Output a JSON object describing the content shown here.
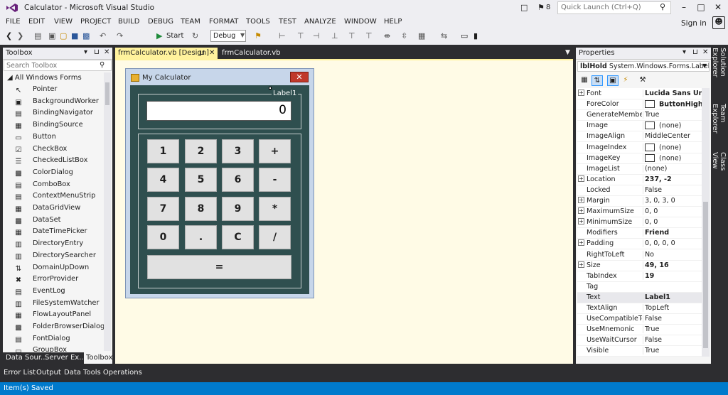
{
  "window": {
    "title": "Calculator - Microsoft Visual Studio",
    "notification_count": "8"
  },
  "quick_launch": {
    "placeholder": "Quick Launch (Ctrl+Q)"
  },
  "menu": [
    "FILE",
    "EDIT",
    "VIEW",
    "PROJECT",
    "BUILD",
    "DEBUG",
    "TEAM",
    "FORMAT",
    "TOOLS",
    "TEST",
    "ANALYZE",
    "WINDOW",
    "HELP"
  ],
  "account": {
    "sign_in": "Sign in"
  },
  "toolbar": {
    "start_label": "Start",
    "config": "Debug"
  },
  "toolbox": {
    "title": "Toolbox",
    "search_placeholder": "Search Toolbox",
    "group": "All Windows Forms",
    "items": [
      {
        "label": "Pointer",
        "icon": "pointer-icon"
      },
      {
        "label": "BackgroundWorker",
        "icon": "background-worker-icon"
      },
      {
        "label": "BindingNavigator",
        "icon": "binding-navigator-icon"
      },
      {
        "label": "BindingSource",
        "icon": "binding-source-icon"
      },
      {
        "label": "Button",
        "icon": "button-icon"
      },
      {
        "label": "CheckBox",
        "icon": "checkbox-icon"
      },
      {
        "label": "CheckedListBox",
        "icon": "checked-listbox-icon"
      },
      {
        "label": "ColorDialog",
        "icon": "color-dialog-icon"
      },
      {
        "label": "ComboBox",
        "icon": "combobox-icon"
      },
      {
        "label": "ContextMenuStrip",
        "icon": "context-menu-icon"
      },
      {
        "label": "DataGridView",
        "icon": "datagrid-icon"
      },
      {
        "label": "DataSet",
        "icon": "dataset-icon"
      },
      {
        "label": "DateTimePicker",
        "icon": "datetime-picker-icon"
      },
      {
        "label": "DirectoryEntry",
        "icon": "directory-entry-icon"
      },
      {
        "label": "DirectorySearcher",
        "icon": "directory-searcher-icon"
      },
      {
        "label": "DomainUpDown",
        "icon": "domain-updown-icon"
      },
      {
        "label": "ErrorProvider",
        "icon": "error-provider-icon"
      },
      {
        "label": "EventLog",
        "icon": "eventlog-icon"
      },
      {
        "label": "FileSystemWatcher",
        "icon": "filesystem-watcher-icon"
      },
      {
        "label": "FlowLayoutPanel",
        "icon": "flow-layout-icon"
      },
      {
        "label": "FolderBrowserDialog",
        "icon": "folder-browser-icon"
      },
      {
        "label": "FontDialog",
        "icon": "font-dialog-icon"
      },
      {
        "label": "GroupBox",
        "icon": "groupbox-icon"
      }
    ],
    "bottom_tabs": [
      "Data Sour...",
      "Server Ex...",
      "Toolbox"
    ]
  },
  "documents": {
    "active_tab": "frmCalculator.vb [Design]",
    "other_tab": "frmCalculator.vb"
  },
  "form": {
    "title": "My Calculator",
    "groupbox_label": "Label1",
    "display_value": "0",
    "buttons": [
      [
        "1",
        "2",
        "3",
        "+"
      ],
      [
        "4",
        "5",
        "6",
        "-"
      ],
      [
        "7",
        "8",
        "9",
        "*"
      ],
      [
        "0",
        ".",
        "C",
        "/"
      ]
    ],
    "equals": "="
  },
  "properties": {
    "title": "Properties",
    "object_name": "lblHold",
    "object_type": "System.Windows.Forms.Label",
    "rows": [
      {
        "name": "Font",
        "value": "Lucida Sans Unicode",
        "bold": true,
        "expand": true
      },
      {
        "name": "ForeColor",
        "value": "ButtonHighlight",
        "bold": true,
        "swatch": true
      },
      {
        "name": "GenerateMember",
        "value": "True"
      },
      {
        "name": "Image",
        "value": "(none)",
        "swatch": true
      },
      {
        "name": "ImageAlign",
        "value": "MiddleCenter"
      },
      {
        "name": "ImageIndex",
        "value": "(none)",
        "swatch": true
      },
      {
        "name": "ImageKey",
        "value": "(none)",
        "swatch": true
      },
      {
        "name": "ImageList",
        "value": "(none)"
      },
      {
        "name": "Location",
        "value": "237, -2",
        "bold": true,
        "expand": true
      },
      {
        "name": "Locked",
        "value": "False"
      },
      {
        "name": "Margin",
        "value": "3, 0, 3, 0",
        "expand": true
      },
      {
        "name": "MaximumSize",
        "value": "0, 0",
        "expand": true
      },
      {
        "name": "MinimumSize",
        "value": "0, 0",
        "expand": true
      },
      {
        "name": "Modifiers",
        "value": "Friend",
        "bold": true
      },
      {
        "name": "Padding",
        "value": "0, 0, 0, 0",
        "expand": true
      },
      {
        "name": "RightToLeft",
        "value": "No"
      },
      {
        "name": "Size",
        "value": "49, 16",
        "bold": true,
        "expand": true
      },
      {
        "name": "TabIndex",
        "value": "19",
        "bold": true
      },
      {
        "name": "Tag",
        "value": ""
      },
      {
        "name": "Text",
        "value": "Label1",
        "bold": true
      },
      {
        "name": "TextAlign",
        "value": "TopLeft"
      },
      {
        "name": "UseCompatibleTextRendering",
        "value": "False"
      },
      {
        "name": "UseMnemonic",
        "value": "True"
      },
      {
        "name": "UseWaitCursor",
        "value": "False"
      },
      {
        "name": "Visible",
        "value": "True"
      }
    ]
  },
  "side_tabs": [
    "Solution Explorer",
    "Team Explorer",
    "Class View"
  ],
  "bottom_tabs": [
    "Error List",
    "Output",
    "Data Tools Operations"
  ],
  "status": {
    "text": "Item(s) Saved"
  }
}
